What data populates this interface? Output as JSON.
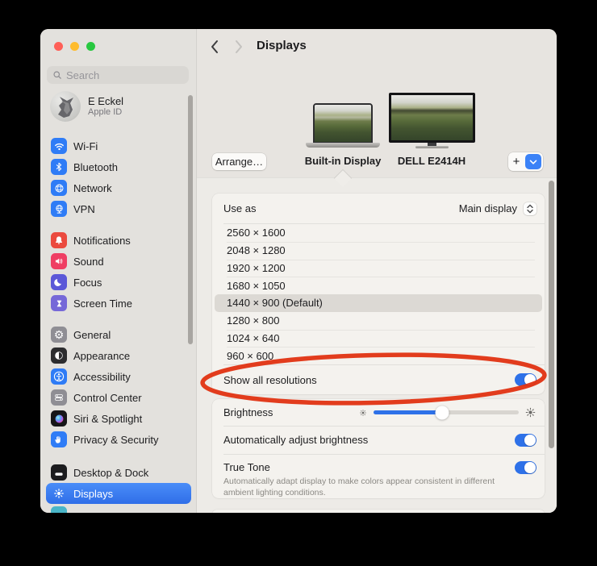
{
  "colors": {
    "accent_blue": "#3b82f7",
    "toggle_on": "#2e71e8",
    "annotation_red": "#e13414",
    "selected_row_bg": "#dcd9d4"
  },
  "sidebar": {
    "search": {
      "placeholder": "Search",
      "icon": "magnifier-icon"
    },
    "profile": {
      "name": "E Eckel",
      "subtitle": "Apple ID"
    },
    "groups": [
      {
        "items": [
          {
            "icon": "wifi-icon",
            "label": "Wi-Fi"
          },
          {
            "icon": "bluetooth-icon",
            "label": "Bluetooth"
          },
          {
            "icon": "network-globe-icon",
            "label": "Network"
          },
          {
            "icon": "vpn-icon",
            "label": "VPN"
          }
        ]
      },
      {
        "items": [
          {
            "icon": "bell-icon",
            "label": "Notifications"
          },
          {
            "icon": "speaker-icon",
            "label": "Sound"
          },
          {
            "icon": "moon-icon",
            "label": "Focus"
          },
          {
            "icon": "hourglass-icon",
            "label": "Screen Time"
          }
        ]
      },
      {
        "items": [
          {
            "icon": "gear-icon",
            "label": "General"
          },
          {
            "icon": "appearance-icon",
            "label": "Appearance"
          },
          {
            "icon": "accessibility-icon",
            "label": "Accessibility"
          },
          {
            "icon": "control-center-icon",
            "label": "Control Center"
          },
          {
            "icon": "siri-icon",
            "label": "Siri & Spotlight"
          },
          {
            "icon": "hand-icon",
            "label": "Privacy & Security"
          }
        ]
      },
      {
        "items": [
          {
            "icon": "dock-icon",
            "label": "Desktop & Dock"
          },
          {
            "icon": "sun-icon",
            "label": "Displays",
            "selected": true
          }
        ]
      }
    ]
  },
  "main": {
    "nav": {
      "title": "Displays",
      "back_icon": "chevron-left-icon",
      "forward_icon": "chevron-right-icon"
    },
    "picker": {
      "arrange_button": "Arrange…",
      "displays": [
        {
          "name": "Built-in Display",
          "kind": "laptop",
          "selected": true
        },
        {
          "name": "DELL E2414H",
          "kind": "external-monitor"
        }
      ],
      "add_button": "+"
    },
    "settings": {
      "use_as": {
        "label": "Use as",
        "value": "Main display"
      },
      "resolutions": [
        "2560 × 1600",
        "2048 × 1280",
        "1920 × 1200",
        "1680 × 1050",
        "1440 × 900 (Default)",
        "1280 × 800",
        "1024 × 640",
        "960 × 600"
      ],
      "selected_resolution": "1440 × 900 (Default)",
      "show_all": {
        "label": "Show all resolutions",
        "enabled": true
      },
      "brightness": {
        "label": "Brightness",
        "percent": 47
      },
      "auto_brightness": {
        "label": "Automatically adjust brightness",
        "enabled": true
      },
      "true_tone": {
        "label": "True Tone",
        "description": "Automatically adapt display to make colors appear consistent in different ambient lighting conditions.",
        "enabled": true
      }
    }
  },
  "annotation": {
    "shape": "ellipse",
    "color": "#e13414"
  }
}
